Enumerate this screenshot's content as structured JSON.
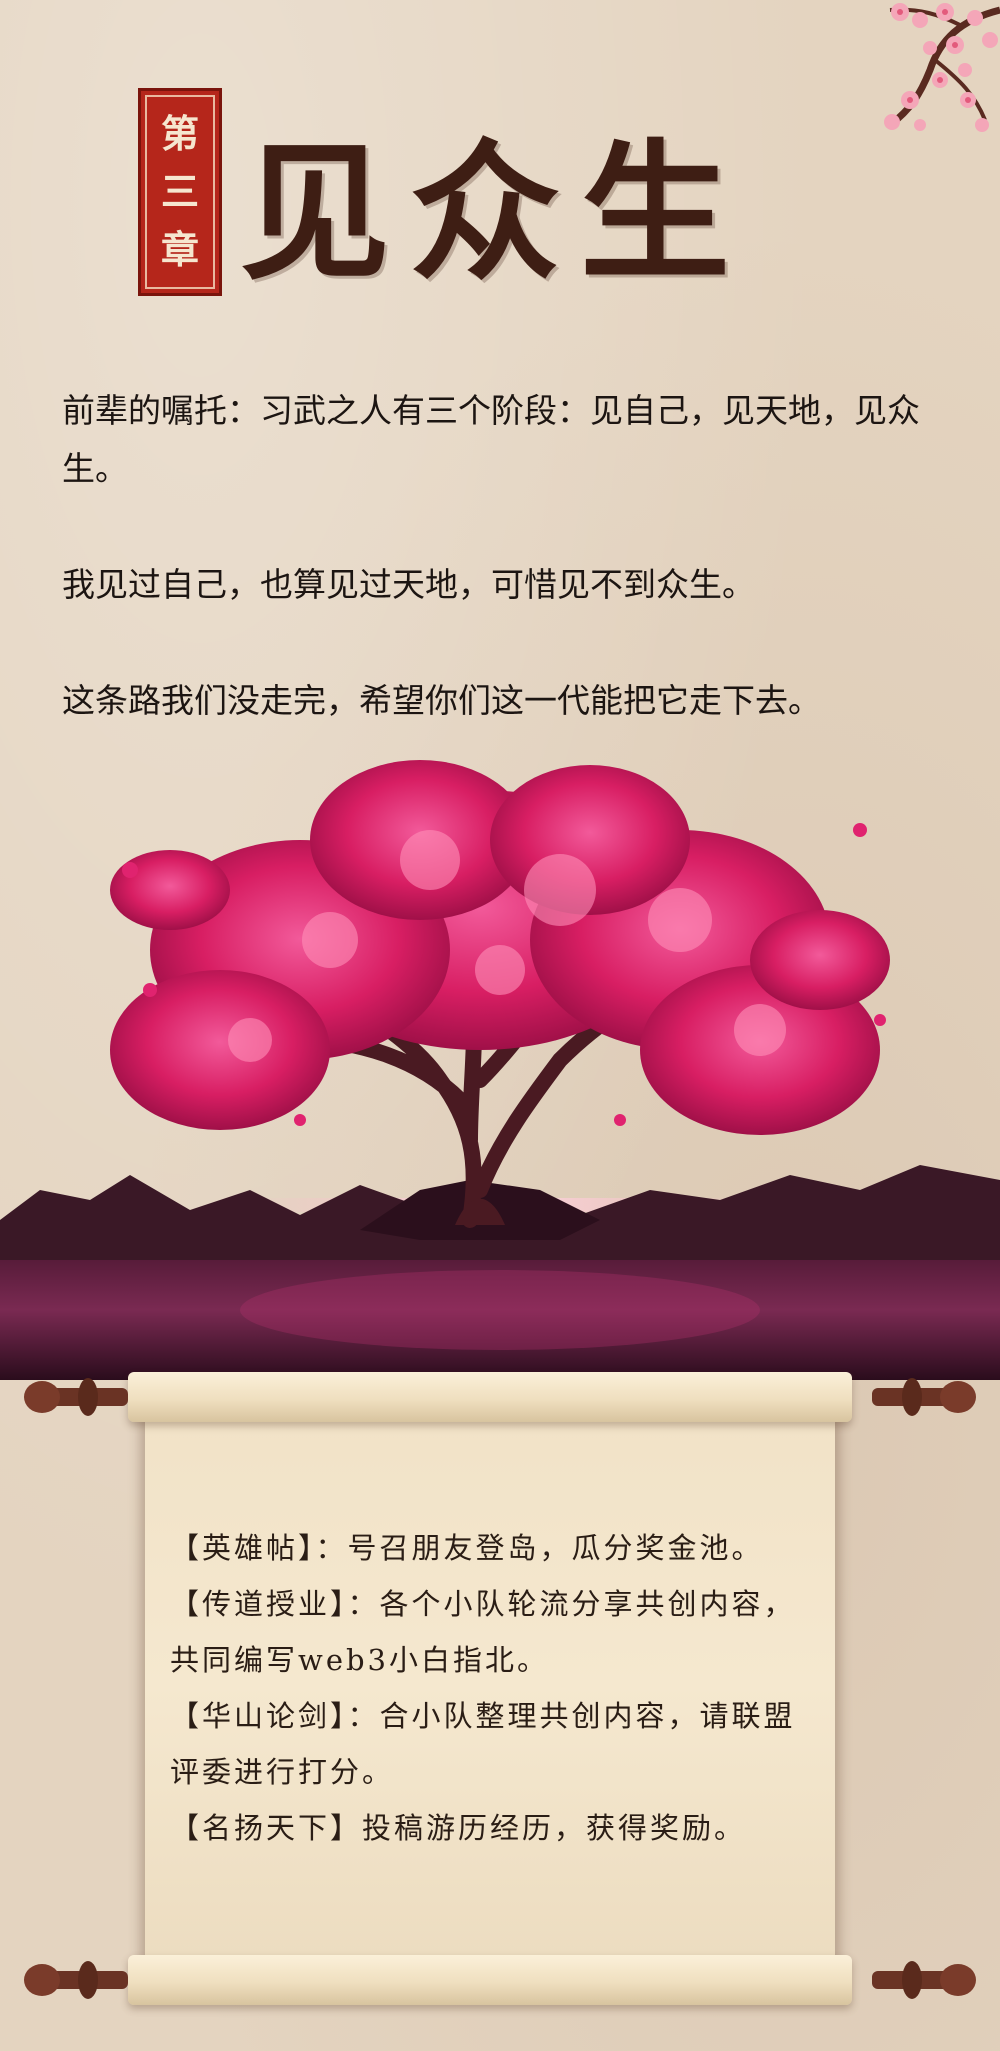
{
  "chapter": {
    "label_chars": [
      "第",
      "三",
      "章"
    ],
    "title": "见众生"
  },
  "intro": {
    "paragraphs": [
      "前辈的嘱托：习武之人有三个阶段：见自己，见天地，见众生。",
      "我见过自己，也算见过天地，可惜见不到众生。",
      "这条路我们没走完，希望你们这一代能把它走下去。"
    ]
  },
  "scroll": {
    "items": [
      "【英雄帖】：号召朋友登岛，瓜分奖金池。",
      "【传道授业】：各个小队轮流分享共创内容，共同编写web3小白指北。",
      "【华山论剑】：合小队整理共创内容，请联盟评委进行打分。",
      "【名扬天下】投稿游历经历，获得奖励。"
    ]
  },
  "colors": {
    "background": "#e4d4c0",
    "seal": "#b5261b",
    "title": "#3e1e14",
    "blossom": "#e0236f",
    "scroll": "#f3e4ca"
  },
  "icons": {
    "seal": "chapter-seal",
    "tree": "cherry-blossom-tree-illustration",
    "branch": "cherry-blossom-branch-illustration"
  }
}
